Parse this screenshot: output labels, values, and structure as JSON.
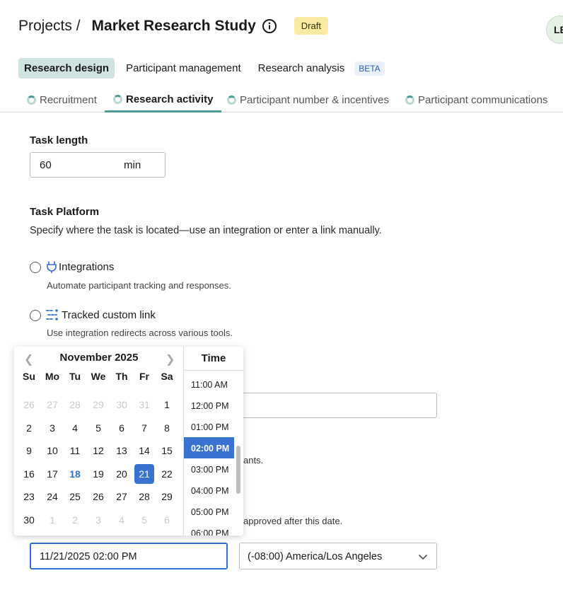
{
  "header": {
    "breadcrumb": "Projects /",
    "title": "Market Research Study",
    "status_badge": "Draft",
    "avatar_initials": "LE"
  },
  "nav_primary": {
    "items": [
      {
        "label": "Research design",
        "active": true
      },
      {
        "label": "Participant management",
        "active": false
      },
      {
        "label": "Research analysis",
        "active": false
      }
    ],
    "beta_badge": "BETA"
  },
  "nav_secondary": {
    "tabs": [
      {
        "label": "Recruitment",
        "active": false
      },
      {
        "label": "Research activity",
        "active": true
      },
      {
        "label": "Participant number & incentives",
        "active": false
      },
      {
        "label": "Participant communications",
        "active": false
      }
    ]
  },
  "task_length": {
    "label": "Task length",
    "value": "60",
    "unit": "min"
  },
  "task_platform": {
    "label": "Task Platform",
    "description": "Specify where the task is located—use an integration or enter a link manually.",
    "options": [
      {
        "label": "Integrations",
        "description": "Automate participant tracking and responses."
      },
      {
        "label": "Tracked custom link",
        "description": "Use integration redirects across various tools."
      }
    ]
  },
  "background_fragments": {
    "ants": "ants.",
    "approved": "approved after this date."
  },
  "calendar": {
    "month": "November 2025",
    "weekdays": [
      "Su",
      "Mo",
      "Tu",
      "We",
      "Th",
      "Fr",
      "Sa"
    ],
    "weeks": [
      [
        "26",
        "27",
        "28",
        "29",
        "30",
        "31",
        "1"
      ],
      [
        "2",
        "3",
        "4",
        "5",
        "6",
        "7",
        "8"
      ],
      [
        "9",
        "10",
        "11",
        "12",
        "13",
        "14",
        "15"
      ],
      [
        "16",
        "17",
        "18",
        "19",
        "20",
        "21",
        "22"
      ],
      [
        "23",
        "24",
        "25",
        "26",
        "27",
        "28",
        "29"
      ],
      [
        "30",
        "1",
        "2",
        "3",
        "4",
        "5",
        "6"
      ]
    ],
    "today": "18",
    "selected": "21",
    "time_header": "Time",
    "times": [
      "11:00 AM",
      "12:00 PM",
      "01:00 PM",
      "02:00 PM",
      "03:00 PM",
      "04:00 PM",
      "05:00 PM",
      "06:00 PM"
    ],
    "selected_time": "02:00 PM"
  },
  "date_input": {
    "value": "11/21/2025 02:00 PM"
  },
  "timezone_select": {
    "value": "(-08:00) America/Los Angeles"
  },
  "colors": {
    "accent": "#3a72d2",
    "teal": "#4b9b94",
    "draft_badge": "#fbeaa3",
    "active_nav": "#cfe3e0"
  }
}
